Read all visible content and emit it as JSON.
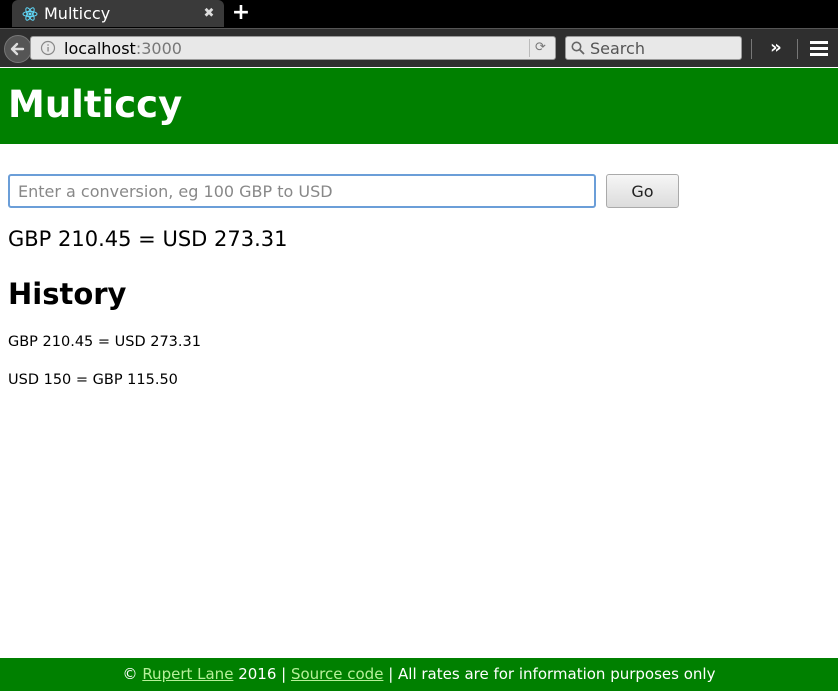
{
  "browser": {
    "tab_title": "Multiccy",
    "tab_close": "✖",
    "new_tab": "+",
    "url_host": "localhost",
    "url_port": ":3000",
    "reload": "⟳",
    "search_placeholder": "Search",
    "overflow": "»"
  },
  "header": {
    "title": "Multiccy"
  },
  "form": {
    "placeholder": "Enter a conversion, eg 100 GBP to USD",
    "value": "",
    "go_label": "Go"
  },
  "result": "GBP 210.45 = USD 273.31",
  "history": {
    "heading": "History",
    "items": [
      "GBP 210.45 = USD 273.31",
      "USD 150 = GBP 115.50"
    ]
  },
  "footer": {
    "copyright": "©",
    "author": "Rupert Lane",
    "year_sep": " 2016 | ",
    "source": "Source code",
    "note": " | All rates are for information purposes only"
  },
  "colors": {
    "brand": "#008000",
    "link": "#b6f09a",
    "focus": "#6b9ed8"
  }
}
